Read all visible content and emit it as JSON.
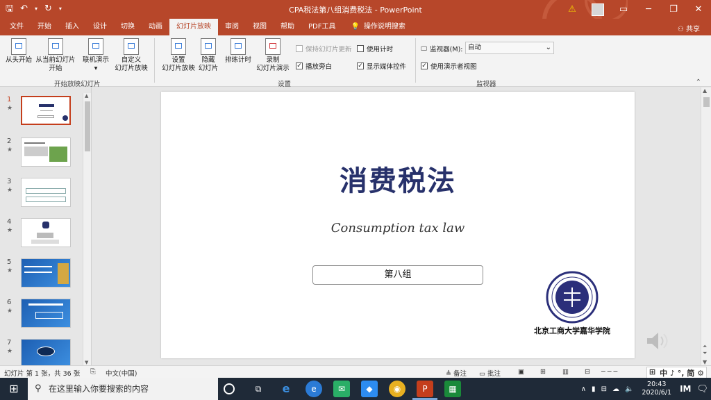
{
  "window": {
    "title": "CPA税法第八组消费税法 - PowerPoint",
    "controls": [
      "⚠",
      "▭",
      "─",
      "❐",
      "✕"
    ]
  },
  "tabs": [
    "文件",
    "开始",
    "插入",
    "设计",
    "切换",
    "动画",
    "幻灯片放映",
    "审阅",
    "视图",
    "帮助",
    "PDF工具"
  ],
  "active_tab": "幻灯片放映",
  "tell_me": "操作说明搜索",
  "share": "共享",
  "ribbon": {
    "start_group": {
      "label": "开始放映幻灯片",
      "from_beginning": "从头开始",
      "from_current_1": "从当前幻灯片",
      "from_current_2": "开始",
      "online_1": "联机演示",
      "custom_1": "自定义",
      "custom_2": "幻灯片放映"
    },
    "setup_group": {
      "label": "设置",
      "setup_1": "设置",
      "setup_2": "幻灯片放映",
      "hide_1": "隐藏",
      "hide_2": "幻灯片",
      "rehearse": "排练计时",
      "record_1": "录制",
      "record_2": "幻灯片演示",
      "keep_updated": "保持幻灯片更新",
      "use_timings": "使用计时",
      "narrations": "播放旁白",
      "media_controls": "显示媒体控件"
    },
    "monitors_group": {
      "label": "监视器",
      "monitor_label": "监视器(M):",
      "monitor_value": "自动",
      "presenter_view": "使用演示者视图"
    }
  },
  "slides": [
    {
      "num": "1"
    },
    {
      "num": "2"
    },
    {
      "num": "3"
    },
    {
      "num": "4"
    },
    {
      "num": "5"
    },
    {
      "num": "6"
    },
    {
      "num": "7"
    }
  ],
  "slide": {
    "title": "消费税法",
    "subtitle": "Consumption tax law",
    "group_box": "第八组",
    "logo_text": "北京工商大学嘉华学院"
  },
  "status": {
    "slide_info": "幻灯片 第 1 张，共 36 张",
    "language": "中文(中国)",
    "notes": "备注",
    "comments": "批注",
    "ime": "中 ♪ °, 简 ⚙"
  },
  "taskbar": {
    "search_placeholder": "在这里输入你要搜索的内容",
    "time": "20:43",
    "date": "2020/6/1",
    "im": "IM"
  },
  "colors": {
    "accent": "#b7472a",
    "slide_title": "#27316b",
    "selected_thumb_border": "#c43e1c"
  }
}
